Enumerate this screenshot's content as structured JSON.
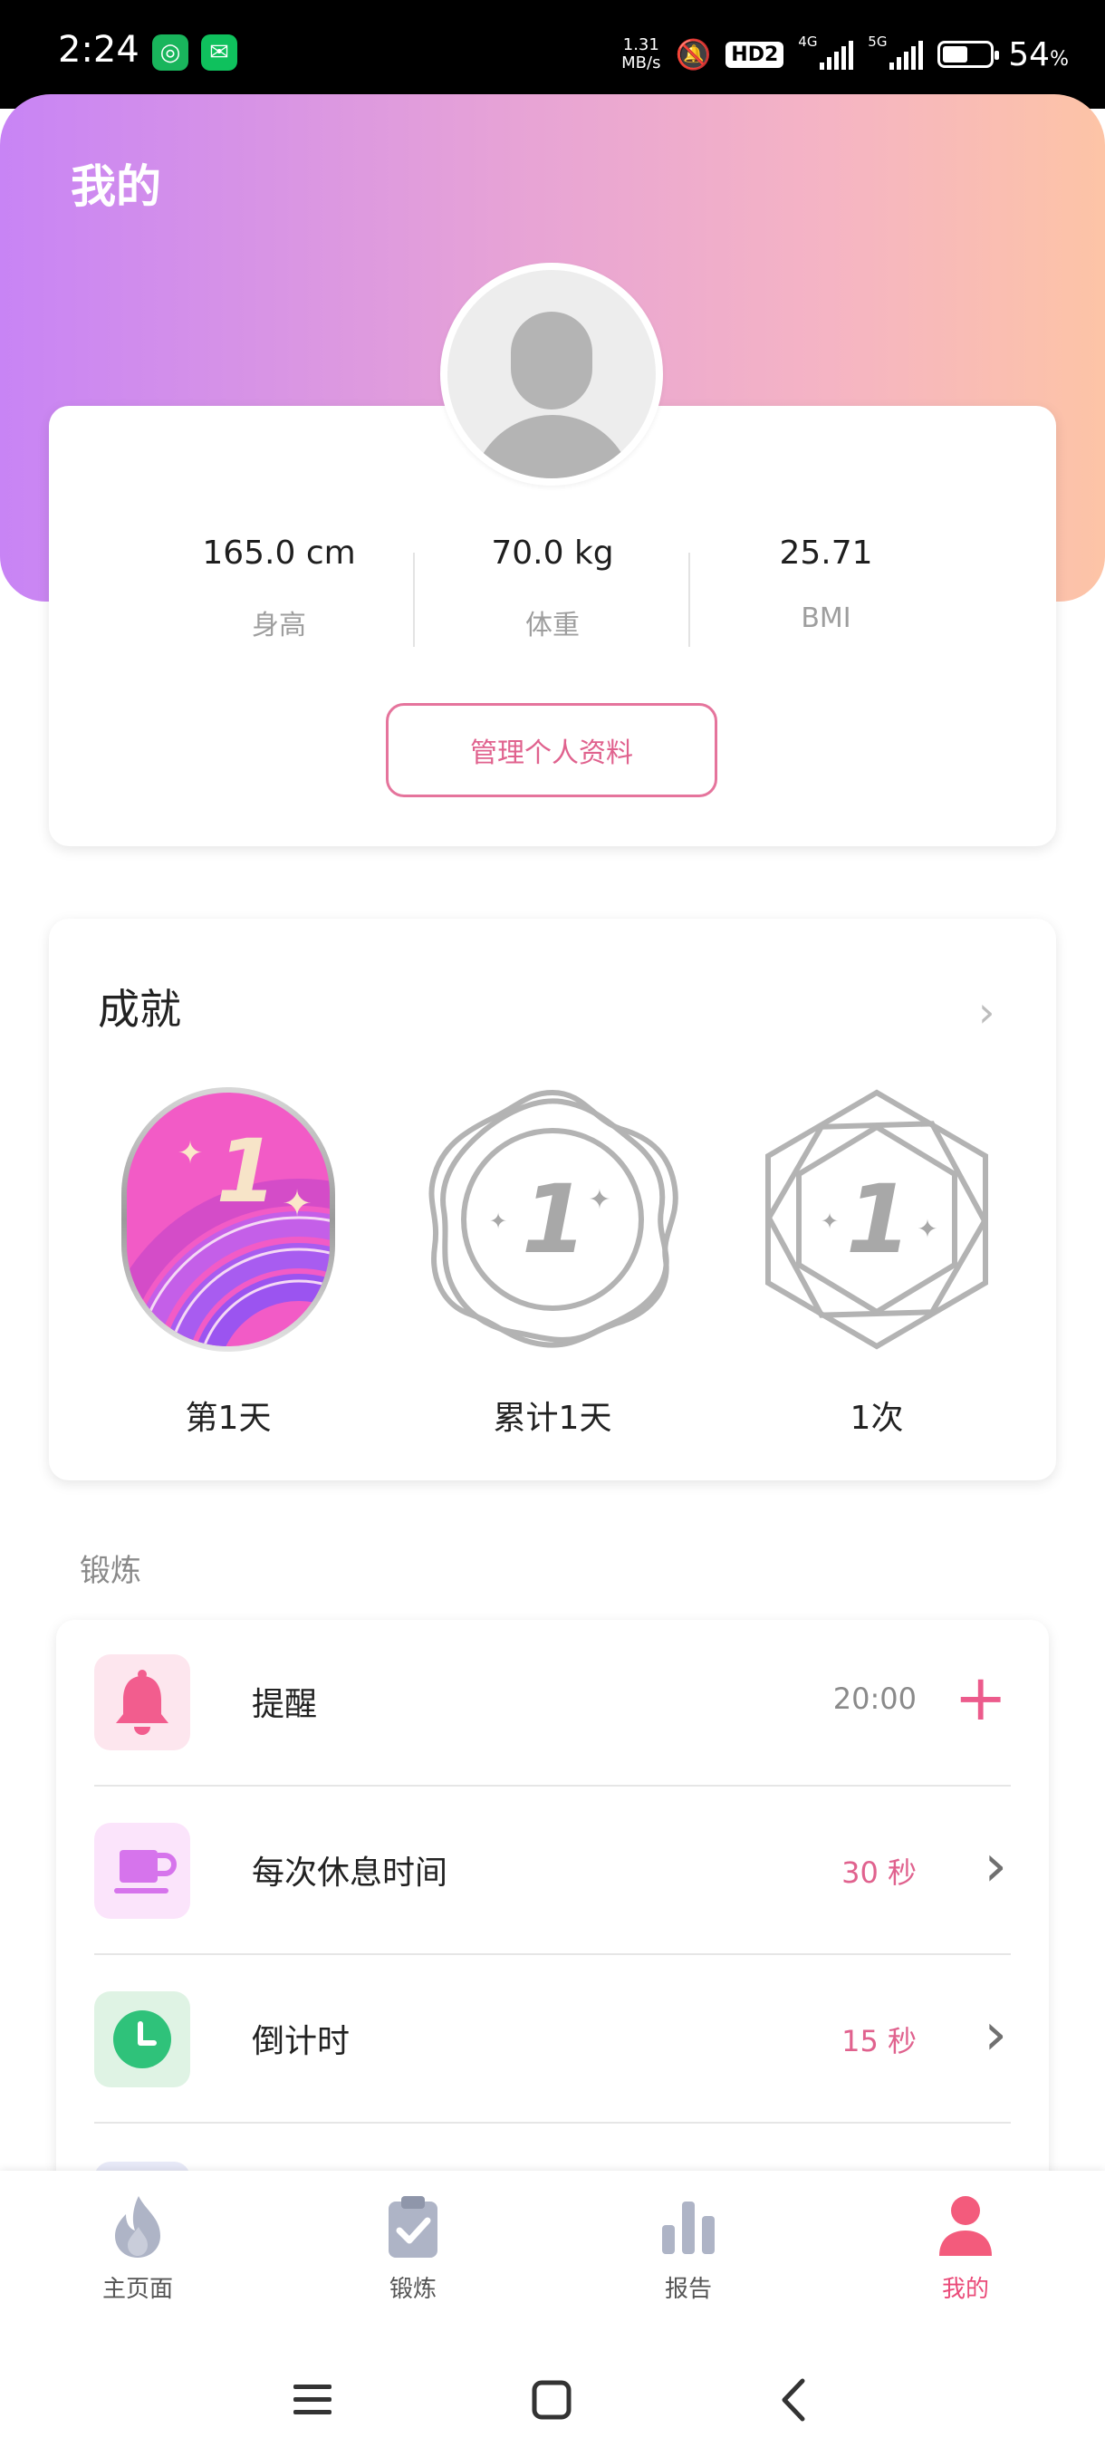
{
  "status_bar": {
    "time": "2:24",
    "net_speed_value": "1.31",
    "net_speed_unit": "MB/s",
    "hd_label": "HD2",
    "signal_1_label": "4G",
    "signal_2_label": "5G",
    "battery_value": "54",
    "battery_unit": "%",
    "battery_level": 0.54
  },
  "header": {
    "title": "我的"
  },
  "profile": {
    "stats": [
      {
        "value": "165.0 cm",
        "label": "身高"
      },
      {
        "value": "70.0 kg",
        "label": "体重"
      },
      {
        "value": "25.71",
        "label": "BMI"
      }
    ],
    "manage_label": "管理个人资料"
  },
  "achievements": {
    "title": "成就",
    "badge_number": "1",
    "badges": [
      {
        "label": "第1天",
        "earned": true
      },
      {
        "label": "累计1天",
        "earned": false
      },
      {
        "label": "1次",
        "earned": false
      }
    ]
  },
  "exercise": {
    "section_label": "锻炼",
    "rows": [
      {
        "label": "提醒",
        "value": "20:00",
        "action": "+",
        "icon": "bell-icon"
      },
      {
        "label": "每次休息时间",
        "value": "30 秒",
        "action": "›",
        "icon": "coffee-cup-icon"
      },
      {
        "label": "倒计时",
        "value": "15 秒",
        "action": "›",
        "icon": "clock-icon"
      }
    ]
  },
  "bottom_nav": {
    "items": [
      {
        "label": "主页面",
        "icon": "flame-icon"
      },
      {
        "label": "锻炼",
        "icon": "clipboard-check-icon"
      },
      {
        "label": "报告",
        "icon": "bar-chart-icon"
      },
      {
        "label": "我的",
        "icon": "person-icon"
      }
    ],
    "active_index": 3
  },
  "colors": {
    "accent": "#e0628e",
    "gradient_start": "#c884f5",
    "gradient_end": "#fdc4a6",
    "time_color": "#8a8a8a"
  }
}
